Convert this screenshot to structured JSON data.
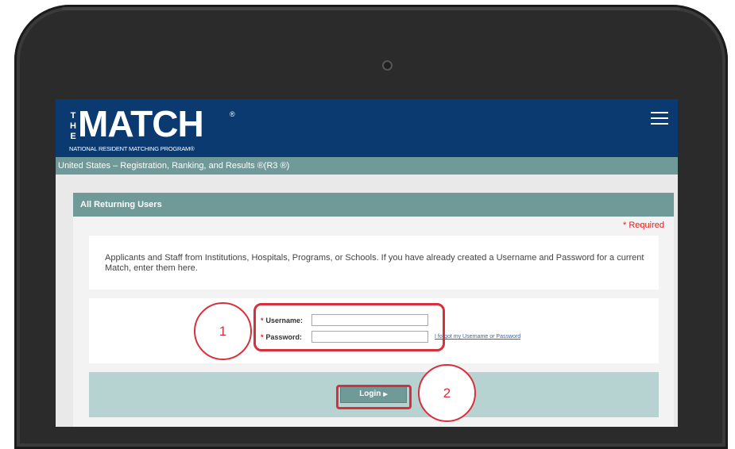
{
  "header": {
    "logo_the": [
      "T",
      "H",
      "E"
    ],
    "logo_word": "MATCH",
    "logo_reg": "®",
    "logo_subtitle": "NATIONAL RESIDENT MATCHING PROGRAM®",
    "menu_icon": "hamburger-menu-icon"
  },
  "subheader": {
    "text": "United States  – Registration, Ranking, and Results ®(R3 ®)"
  },
  "panel": {
    "title": "All Returning Users",
    "required_note": "* Required",
    "info_text": "Applicants and Staff from Institutions, Hospitals, Programs, or Schools. If you have already created a Username and Password for a current Match, enter them here.",
    "username_label": "Username:",
    "username_value": "",
    "password_label": "Password:",
    "password_value": "",
    "required_marker": "*",
    "forgot_link": "I forgot my Username or Password",
    "login_label": "Login",
    "login_arrow": "▶"
  },
  "annotations": {
    "badge_1": "1",
    "badge_2": "2",
    "highlight_color": "#d6303c"
  },
  "colors": {
    "header_bg": "#0b3a70",
    "teal": "#6f9a98",
    "action_bar": "#b6d3d1",
    "required": "#e02020"
  }
}
